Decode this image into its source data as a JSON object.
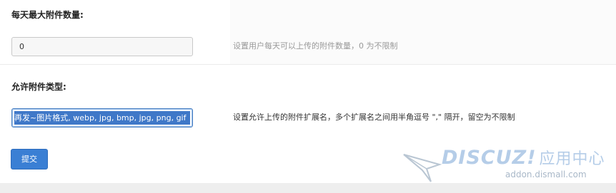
{
  "settings": {
    "max_daily_attachments": {
      "label": "每天最大附件数量:",
      "value": "0",
      "hint": "设置用户每天可以上传的附件数量，0 为不限制"
    },
    "allowed_attachment_types": {
      "label": "允许附件类型:",
      "value": "再发~图片格式, webp, jpg, bmp, jpg, png, gif",
      "hint": "设置允许上传的附件扩展名，多个扩展名之间用半角逗号 \",\" 隔开，留空为不限制"
    }
  },
  "submit_label": "提交",
  "watermark": {
    "brand": "DISCUZ!",
    "brand_cn": "应用中心",
    "url": "addon.dismall.com"
  },
  "colors": {
    "primary": "#3a7fd4",
    "selection": "#3f78c8",
    "hint": "#999999"
  }
}
